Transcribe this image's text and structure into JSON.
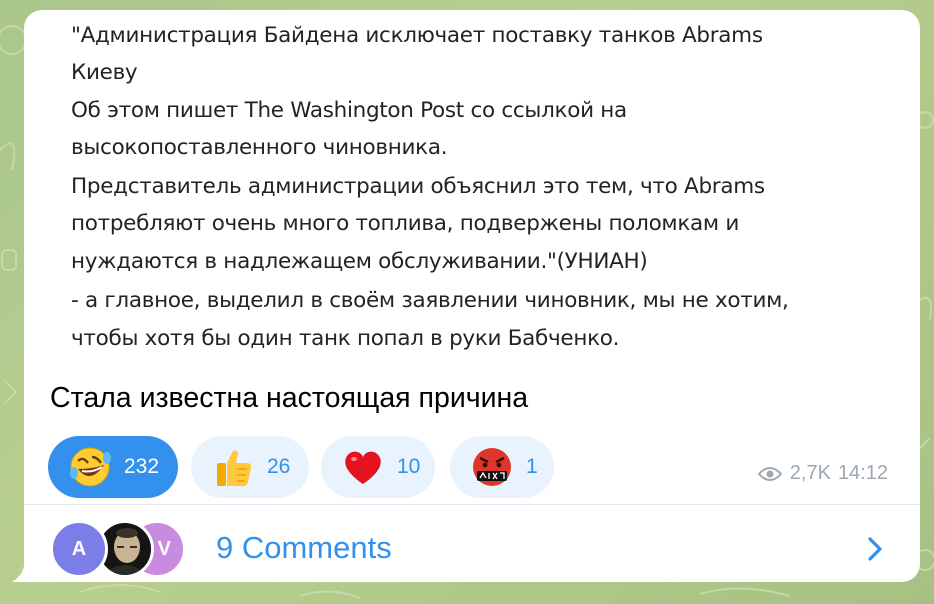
{
  "quote": {
    "lines": [
      "\"Администрация Байдена исключает поставку танков Abrams",
      "Киеву",
      "Об этом пишет The Washington Post со ссылкой на",
      "высокопоставленного чиновника.",
      "Представитель администрации объяснил это тем, что Abrams",
      "потребляют очень много топлива, подвержены поломкам и",
      "нуждаются в надлежащем обслуживании.\"(УНИАН)",
      "- а главное, выделил в своём заявлении чиновник, мы не хотим,",
      "чтобы хотя бы один танк попал в руки Бабченко."
    ]
  },
  "caption": "Стала известна настоящая причина",
  "reactions": [
    {
      "icon": "rofl-emoji-icon",
      "count": "232",
      "chosen": true
    },
    {
      "icon": "thumbs-up-emoji-icon",
      "count": "26",
      "chosen": false
    },
    {
      "icon": "red-heart-emoji-icon",
      "count": "10",
      "chosen": false
    },
    {
      "icon": "cursing-face-emoji-icon",
      "count": "1",
      "chosen": false
    }
  ],
  "meta": {
    "views": "2,7K",
    "time": "14:12"
  },
  "comments": {
    "label": "9 Comments",
    "avatars": [
      {
        "letter": "A",
        "color": "#7c7ee8"
      },
      {
        "letter": "",
        "color": "#222222"
      },
      {
        "letter": "V",
        "color": "#c98be0"
      }
    ]
  },
  "colors": {
    "accent": "#3390ec",
    "bubble": "#ffffff",
    "background": "#b1c98b"
  }
}
